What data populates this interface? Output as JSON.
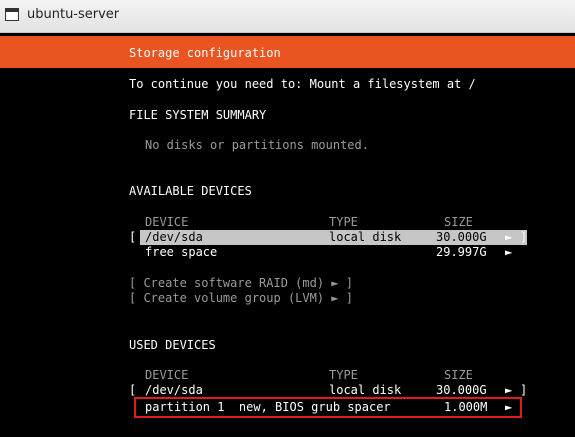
{
  "window": {
    "title": "ubuntu-server",
    "icon": "terminal-window-icon"
  },
  "header": {
    "title": "Storage configuration"
  },
  "instructions": "To continue you need to: Mount a filesystem at /",
  "fs_summary": {
    "heading": "FILE SYSTEM SUMMARY",
    "empty_message": "No disks or partitions mounted."
  },
  "available": {
    "heading": "AVAILABLE DEVICES",
    "columns": {
      "device": "DEVICE",
      "type": "TYPE",
      "size": "SIZE"
    },
    "rows": [
      {
        "open": "[",
        "device": "/dev/sda",
        "type": "local disk",
        "size": "30.000G",
        "arrow": "►",
        "close": "]"
      },
      {
        "device": "free space",
        "type": "",
        "size": "29.997G",
        "arrow": "►"
      }
    ],
    "actions": [
      "[ Create software RAID (md) ► ]",
      "[ Create volume group (LVM) ► ]"
    ]
  },
  "used": {
    "heading": "USED DEVICES",
    "columns": {
      "device": "DEVICE",
      "type": "TYPE",
      "size": "SIZE"
    },
    "rows": [
      {
        "open": "[",
        "device": "/dev/sda",
        "type": "local disk",
        "size": "30.000G",
        "arrow": "►",
        "close": "]"
      },
      {
        "device": "partition 1  new, BIOS grub spacer",
        "size": "1.000M",
        "arrow": "►"
      }
    ]
  },
  "colors": {
    "header": "#e95420",
    "background": "#000000",
    "text": "#ffffff",
    "dim_text": "#9a9a9a",
    "selection": "#c6c6c6",
    "annotation": "#e01b1b"
  }
}
